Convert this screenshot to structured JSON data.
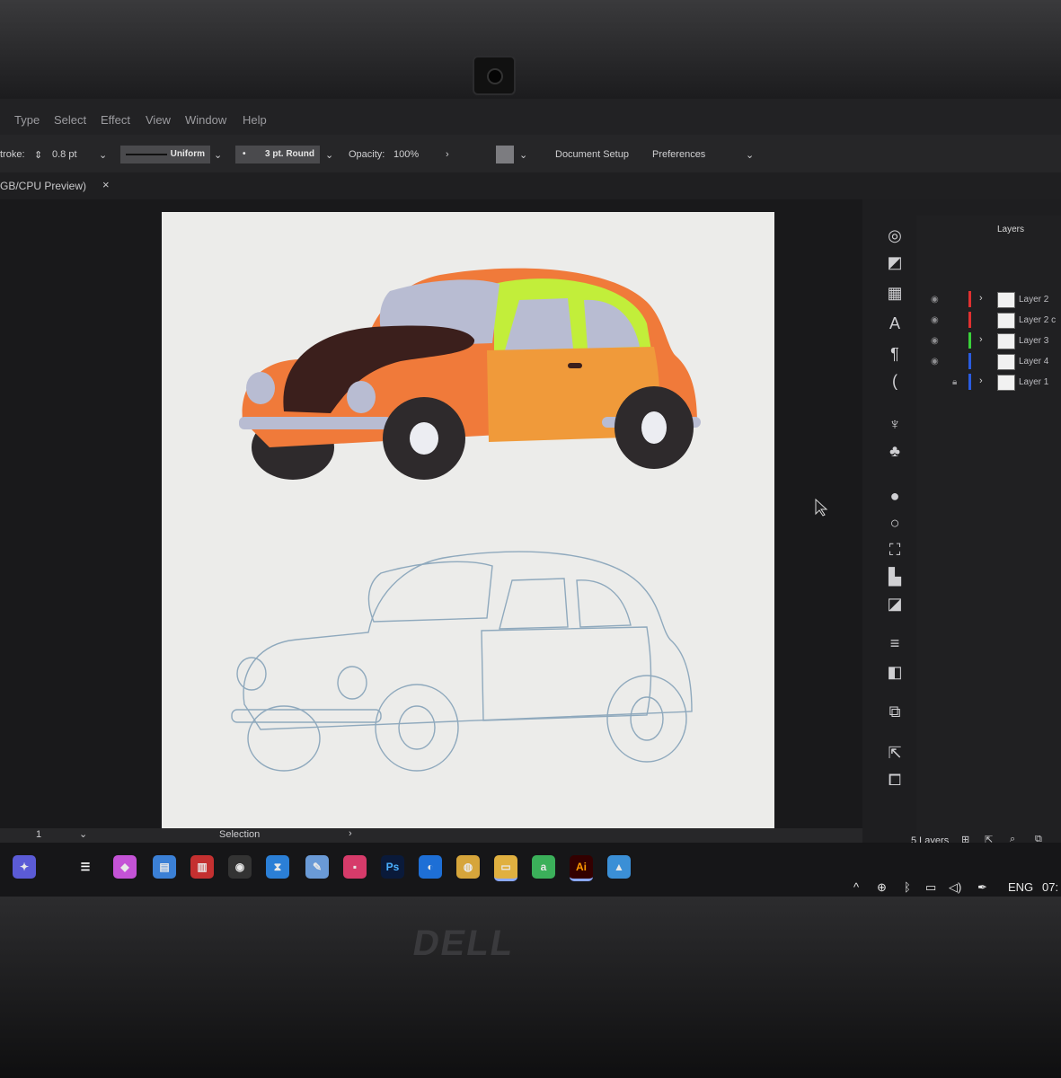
{
  "menu": {
    "items": [
      "Type",
      "Select",
      "Effect",
      "View",
      "Window",
      "Help"
    ]
  },
  "control_bar": {
    "stroke_label": "troke:",
    "stroke_value": "0.8 pt",
    "profile": "Uniform",
    "brush": "3 pt. Round",
    "opacity_label": "Opacity:",
    "opacity_value": "100%",
    "document_setup": "Document Setup",
    "preferences": "Preferences"
  },
  "tab": {
    "title": "GB/CPU Preview)",
    "close": "×"
  },
  "layers_panel": {
    "title": "Layers",
    "layers": [
      {
        "name": "Layer 2",
        "color": "#e03030",
        "expandable": true,
        "visible": true
      },
      {
        "name": "Layer 2 c",
        "color": "#e03030",
        "expandable": false,
        "visible": true
      },
      {
        "name": "Layer 3",
        "color": "#3ad13a",
        "expandable": true,
        "visible": true
      },
      {
        "name": "Layer 4",
        "color": "#2a5ce0",
        "expandable": false,
        "visible": true
      },
      {
        "name": "Layer 1",
        "color": "#2a5ce0",
        "expandable": true,
        "visible": false,
        "locked": true
      }
    ],
    "count_label": "5 Layers"
  },
  "status_bar": {
    "page": "1",
    "tool": "Selection"
  },
  "taskbar": {
    "language": "ENG",
    "time": "07:"
  },
  "colors": {
    "car_body": "#f07a3a",
    "car_roof": "#c2ee3a",
    "car_hood": "#3b1f1c",
    "window": "#b8bcd2",
    "outline": "#8fa9bd"
  },
  "brand": "DELL"
}
